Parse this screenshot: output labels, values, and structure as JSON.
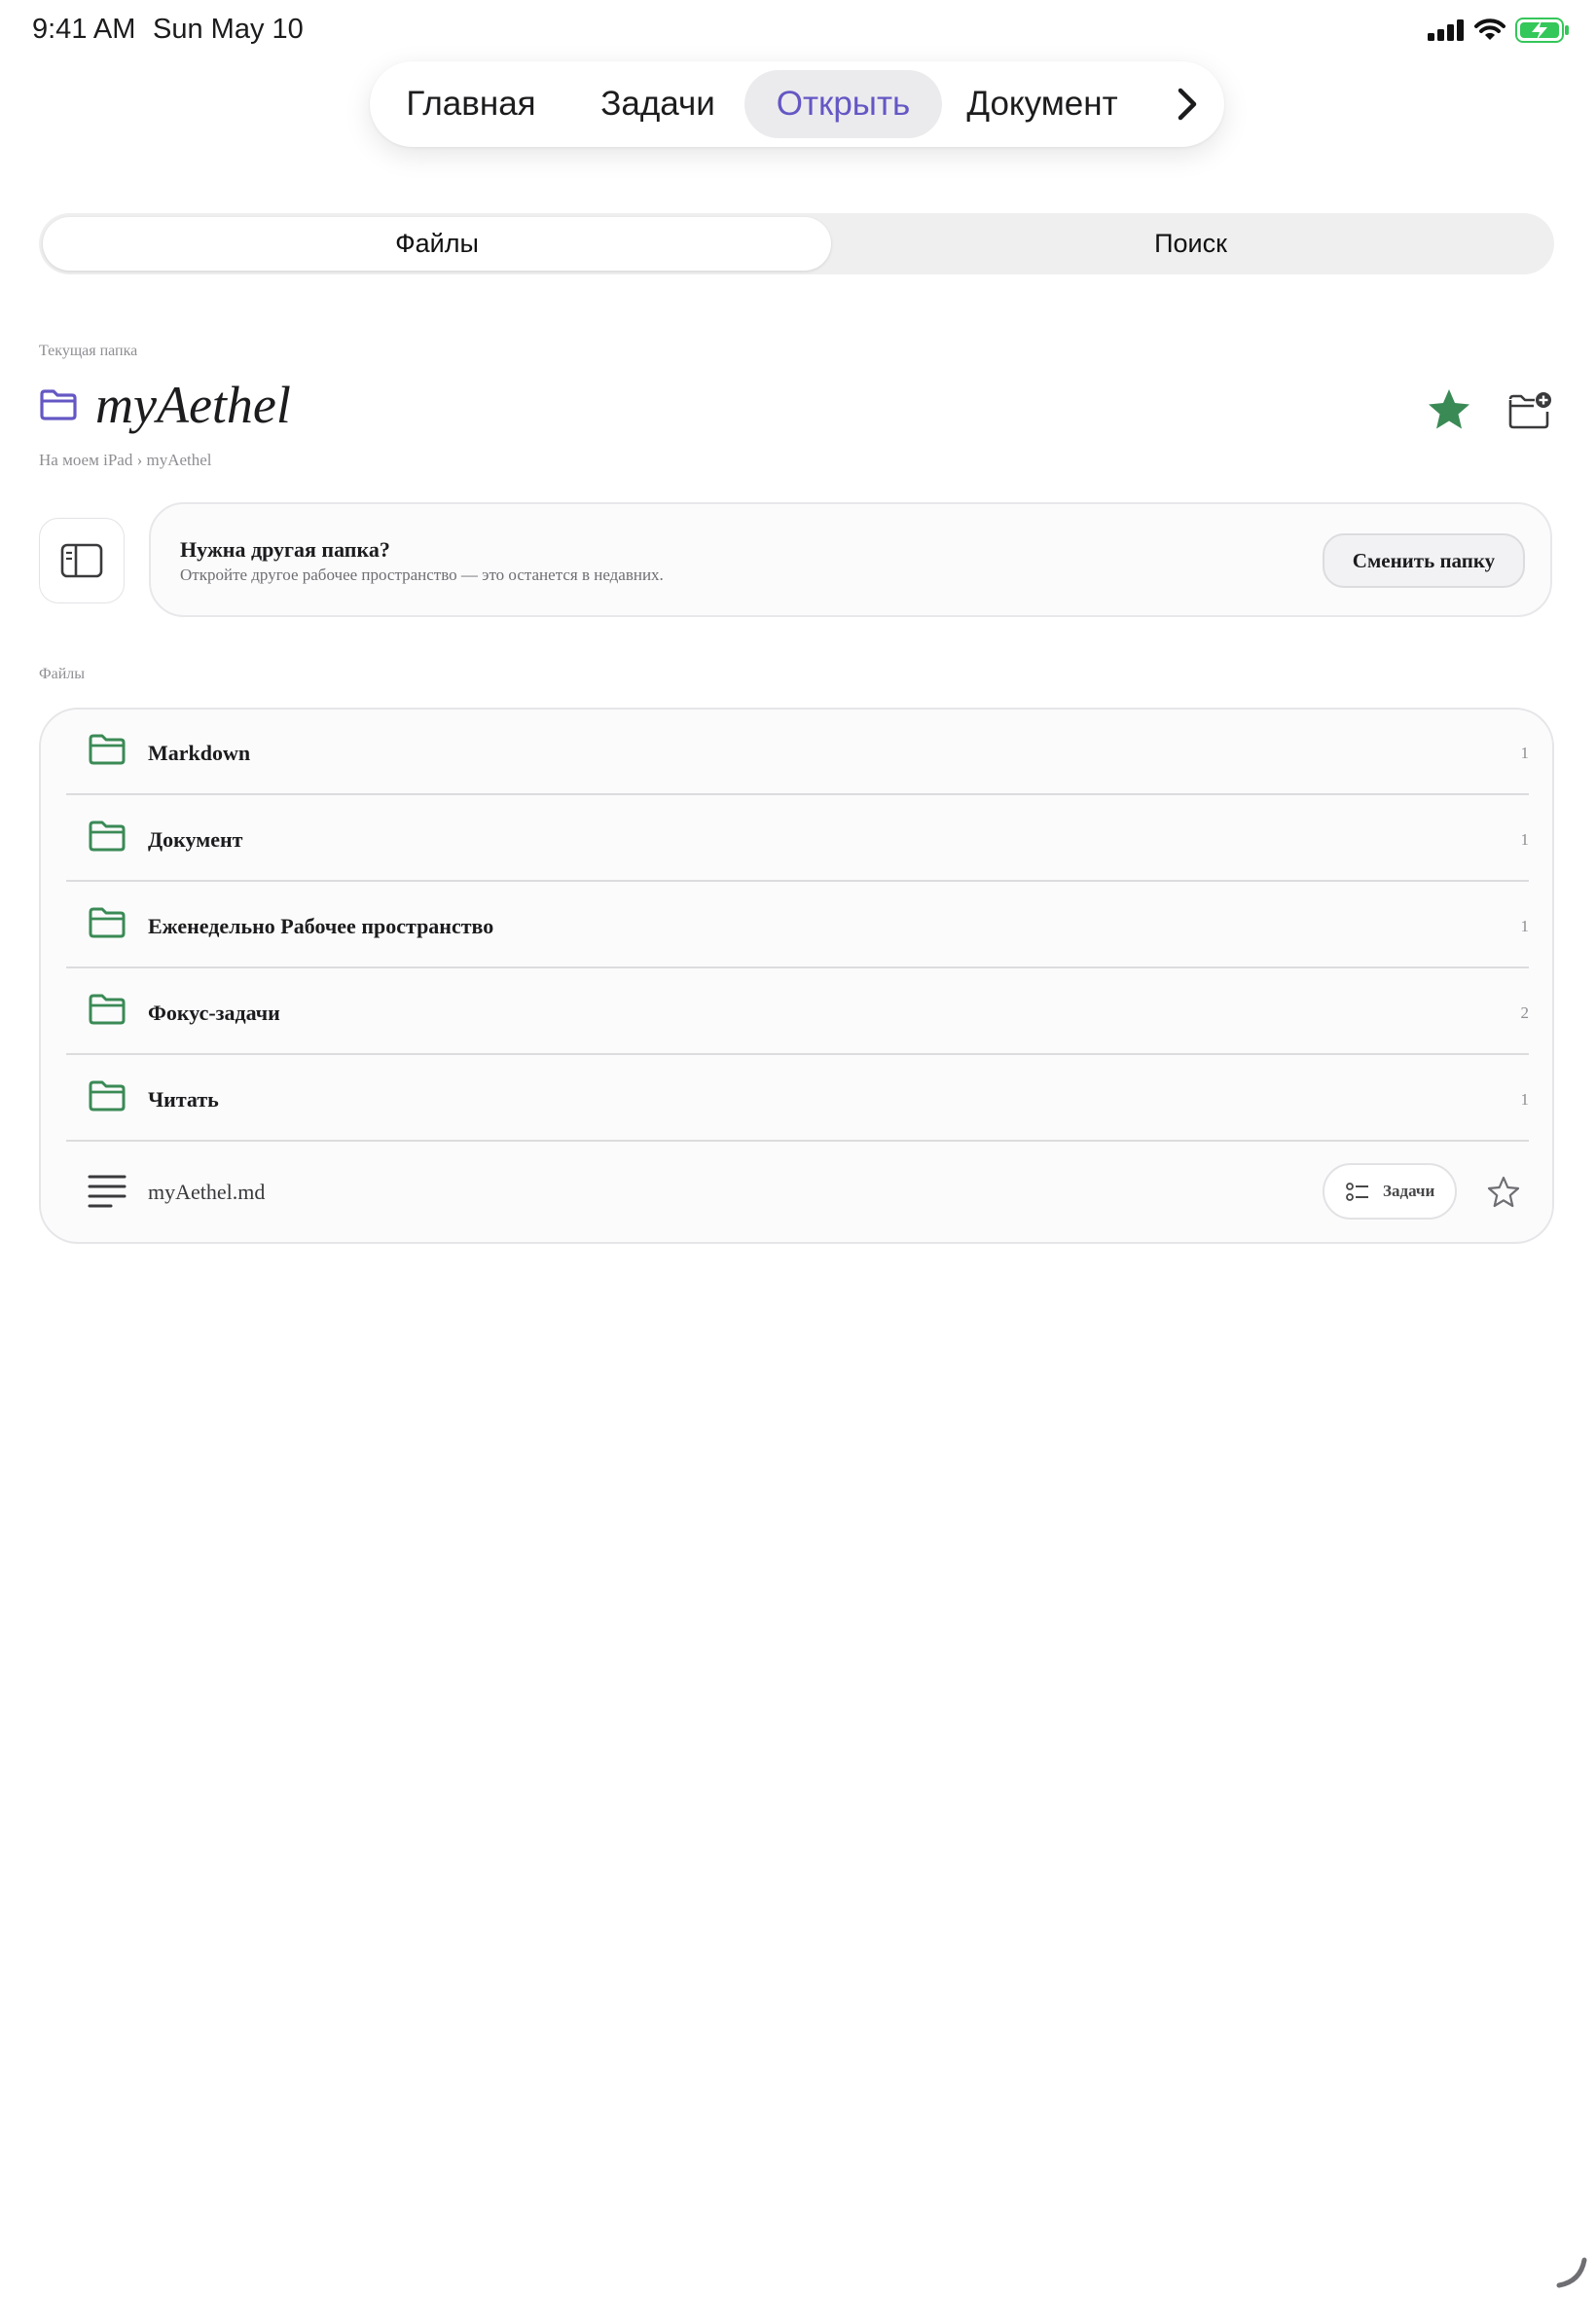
{
  "status_bar": {
    "time": "9:41 AM",
    "date": "Sun May 10",
    "battery_color": "#34c759"
  },
  "top_nav": {
    "tabs": [
      {
        "label": "Главная"
      },
      {
        "label": "Задачи"
      },
      {
        "label": "Открыть",
        "active": true
      },
      {
        "label": "Документ"
      }
    ],
    "more_icon": "chevron-right-icon",
    "accent_color": "#6457c4"
  },
  "segmented": {
    "files": "Файлы",
    "search": "Поиск",
    "selected": "Файлы"
  },
  "current_folder": {
    "label": "Текущая папка",
    "name": "myAethel",
    "breadcrumb": "На моем iPad › myAethel",
    "is_favorite": true,
    "favorite_color": "#3a8a55"
  },
  "change_folder_card": {
    "title": "Нужна другая папка?",
    "subtitle": "Откройте другое рабочее пространство — это останется в недавних.",
    "button": "Сменить папку"
  },
  "files_section": {
    "label": "Файлы",
    "folders": [
      {
        "name": "Markdown",
        "count": "1"
      },
      {
        "name": "Документ",
        "count": "1"
      },
      {
        "name": "Еженедельно Рабочее пространство",
        "count": "1"
      },
      {
        "name": "Фокус-задачи",
        "count": "2"
      },
      {
        "name": "Читать",
        "count": "1"
      }
    ],
    "file": {
      "name": "myAethel.md",
      "chip_label": "Задачи",
      "is_favorite": false
    },
    "folder_icon_color": "#3a8a55"
  }
}
